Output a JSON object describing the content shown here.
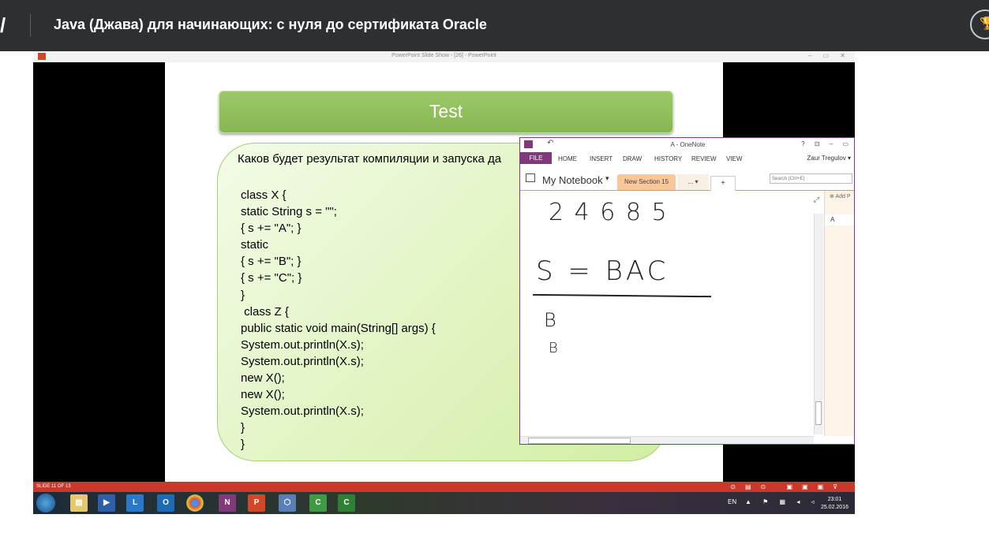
{
  "course": {
    "title": "Java (Джава) для начинающих: с нуля до сертификата Oracle",
    "logo": "/"
  },
  "powerpoint": {
    "window_title": "PowerPoint Slide Show - [26] - PowerPoint",
    "controls": "–  ▭  ✕"
  },
  "slide": {
    "title": "Test",
    "question": "Каков будет результат компиляции и запуска да",
    "code": "class X {\nstatic String s = \"\";\n{ s += \"A\"; }\nstatic\n{ s += \"B\"; }\n{ s += \"C\"; }\n}\n class Z {\npublic static void main(String[] args) {\nSystem.out.println(X.s);\nSystem.out.println(X.s);\nnew X();\nnew X();\nSystem.out.println(X.s);\n}\n}"
  },
  "onenote": {
    "window_title": "A - OneNote",
    "title_controls": "?  ⊡  –  ▭",
    "tabs": {
      "file": "FILE",
      "home": "HOME",
      "insert": "INSERT",
      "draw": "DRAW",
      "history": "HISTORY",
      "review": "REVIEW",
      "view": "VIEW"
    },
    "user": "Zaur Tregulov ▾",
    "notebook": "My Notebook",
    "section": "New Section 15",
    "more_sections": "... ▾",
    "add_section": "+",
    "search_placeholder": "Search (Ctrl+E)",
    "add_page": "⊕ Add P",
    "page_item": "A",
    "ink": {
      "line1": "2 4 6 8 5",
      "line2": "S = BAC",
      "line3": "B",
      "line4": "B"
    }
  },
  "statusbar": {
    "slide_info": "SLIDE 11 OF 13",
    "icons": "⊙▤⊙ ▣▣▣⊽"
  },
  "taskbar": {
    "apps": [
      "file-explorer",
      "media-player",
      "lync",
      "outlook",
      "chrome",
      "onenote",
      "powerpoint",
      "virtualbox",
      "camtasia",
      "camtasia-recorder"
    ],
    "language": "EN",
    "tray": "▲ ⚑ ▦ ◂ ◃",
    "time": "23:01",
    "date": "25.02.2016"
  }
}
